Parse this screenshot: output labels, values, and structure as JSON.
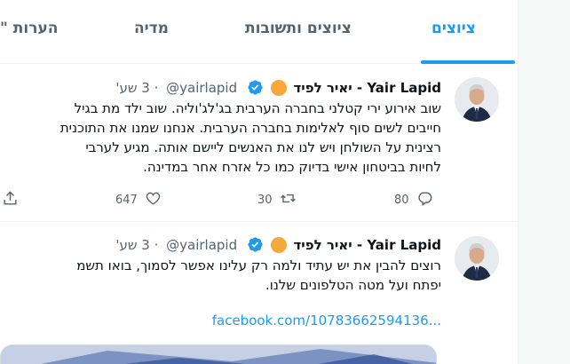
{
  "tabs": [
    {
      "label": "ציוצים",
      "active": true
    },
    {
      "label": "ציוצים ותשובות",
      "active": false
    },
    {
      "label": "מדיה",
      "active": false
    },
    {
      "label": "הערות \"",
      "active": false
    }
  ],
  "colors": {
    "accent": "#1d9bf0",
    "secondary_text": "#536471",
    "verified": "#1d9bf0",
    "label_badge": "#f6a83b"
  },
  "tweets": [
    {
      "name": "יאיר לפיד - Yair Lapid",
      "handle": "@yairlapid",
      "separator": "·",
      "time": "3 שע'",
      "lines": [
        "שוב אירוע ירי קטלני בחברה הערבית בג'לג'וליה. שוב ילד מת בגיל",
        "חייבים לשים סוף לאלימות בחברה הערבית. אנחנו שמנו את התוכנית",
        "רצינית על השולחן ויש לנו את האנשים ליישם אותה. מגיע לערבי",
        "לחיות בביטחון אישי בדיוק כמו כל אזרח אחר במדינה."
      ],
      "reply_count": "80",
      "retweet_count": "30",
      "like_count": "647"
    },
    {
      "name": "יאיר לפיד - Yair Lapid",
      "handle": "@yairlapid",
      "separator": "·",
      "time": "3 שע'",
      "lines": [
        "רוצים להבין את יש עתיד ולמה רק עלינו אפשר לסמוך, בואו תשמ",
        "יפתח ועל מטה הטלפונים שלנו."
      ],
      "link": "facebook.com/10783662594136..."
    }
  ],
  "icons": [
    "verified-badge-icon",
    "reply-icon",
    "retweet-icon",
    "like-icon",
    "share-icon"
  ]
}
